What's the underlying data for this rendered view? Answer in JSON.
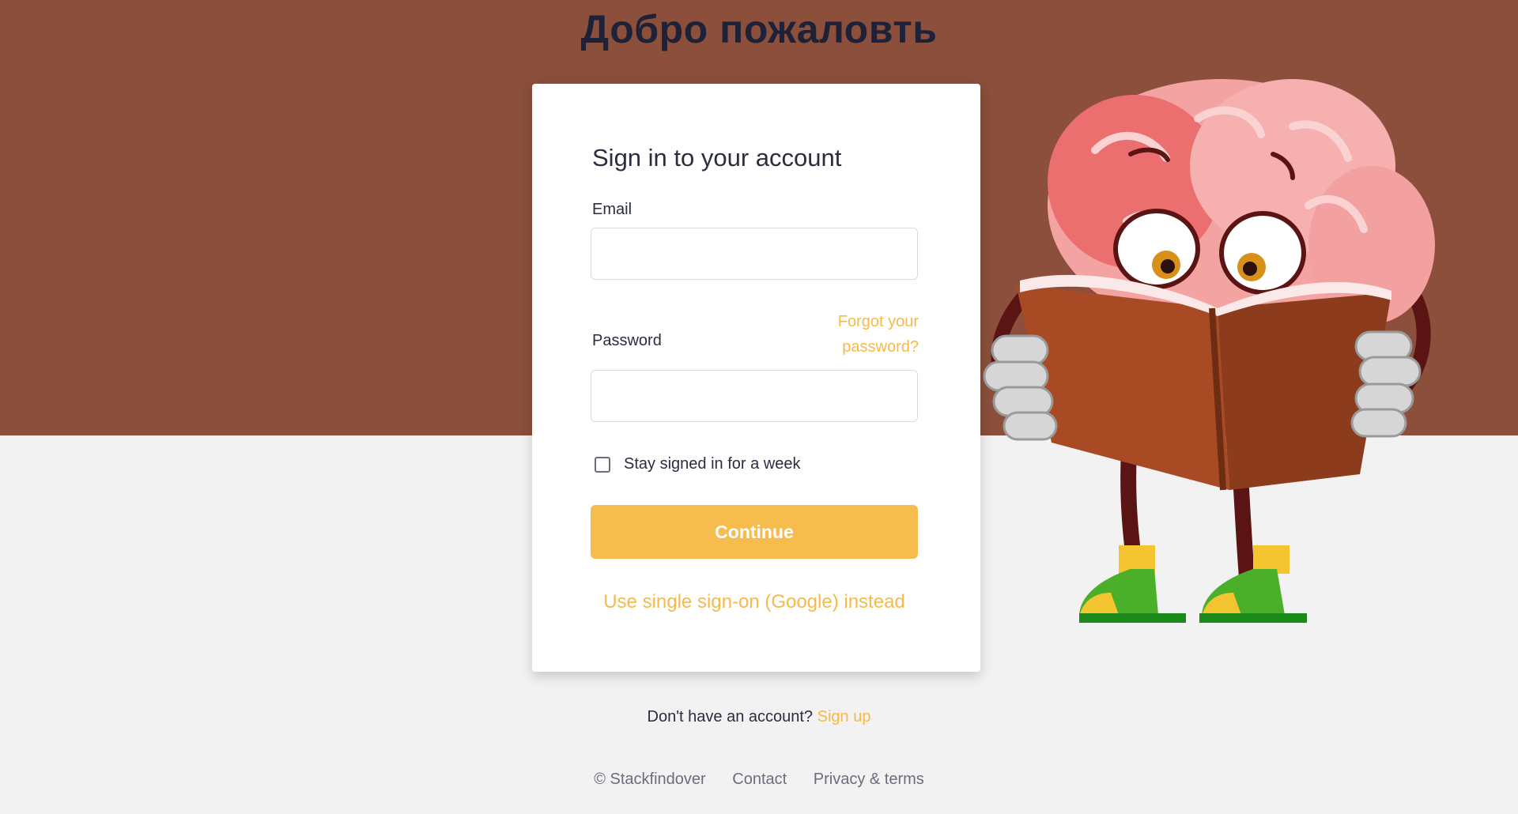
{
  "header": {
    "welcome_title": "Добро пожаловть"
  },
  "signin": {
    "title": "Sign in to your account",
    "email_label": "Email",
    "email_value": "",
    "email_placeholder": "",
    "password_label": "Password",
    "password_value": "",
    "password_placeholder": "",
    "forgot_link": "Forgot your password?",
    "remember_label": "Stay signed in for a week",
    "remember_checked": false,
    "continue_label": "Continue",
    "sso_link": "Use single sign-on (Google) instead"
  },
  "signup": {
    "prompt": "Don't have an account?",
    "link": "Sign up"
  },
  "footer": {
    "copyright": "© Stackfindover",
    "contact": "Contact",
    "privacy": "Privacy & terms"
  },
  "colors": {
    "band": "#8b4f3c",
    "background": "#f2f2f2",
    "accent": "#f6bd4e",
    "title": "#1e2238"
  },
  "illustration": {
    "icon": "brain-mascot-reading-book"
  }
}
